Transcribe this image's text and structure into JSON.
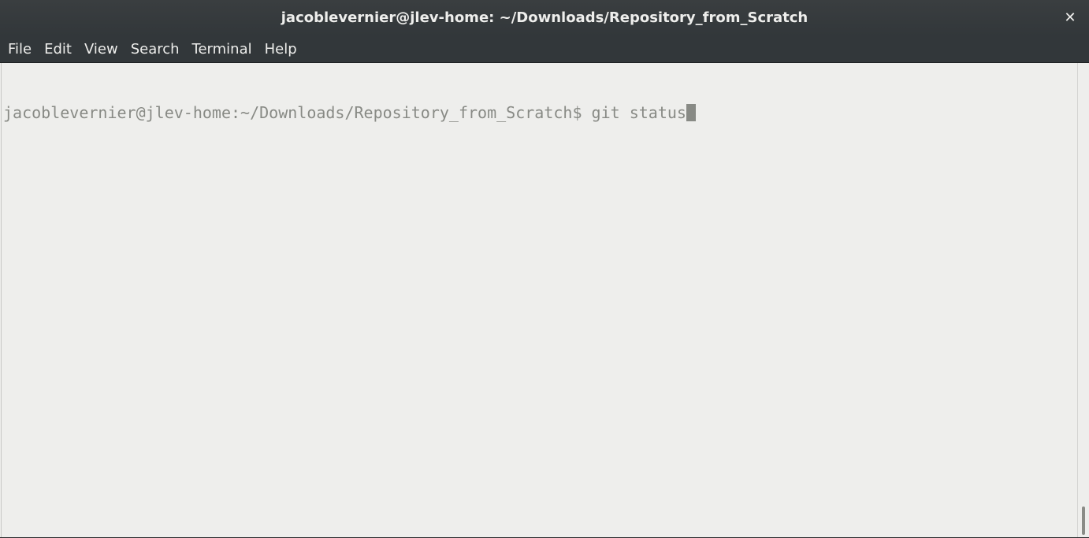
{
  "window": {
    "title": "jacoblevernier@jlev-home: ~/Downloads/Repository_from_Scratch",
    "close_glyph": "✕"
  },
  "menubar": {
    "items": [
      {
        "label": "File"
      },
      {
        "label": "Edit"
      },
      {
        "label": "View"
      },
      {
        "label": "Search"
      },
      {
        "label": "Terminal"
      },
      {
        "label": "Help"
      }
    ]
  },
  "terminal": {
    "prompt": "jacoblevernier@jlev-home:~/Downloads/Repository_from_Scratch$ ",
    "command": "git status",
    "text_color": "#888a85",
    "background_color": "#eeeeec"
  },
  "colors": {
    "titlebar": "#32373a",
    "title_text": "#eeeeec"
  }
}
